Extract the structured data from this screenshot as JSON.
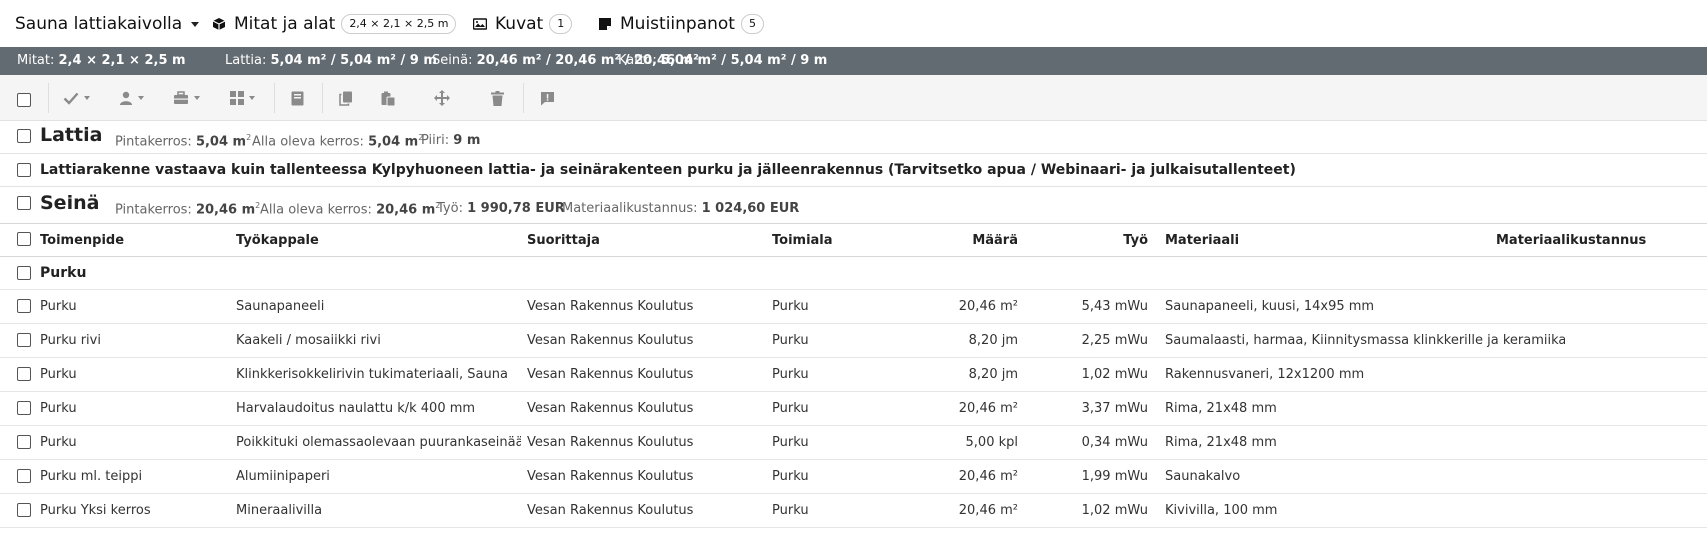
{
  "nav": {
    "title": "Sauna lattiakaivolla",
    "dimensions_label": "Mitat ja alat",
    "dimensions_badge": "2,4 × 2,1 × 2,5 m",
    "images_label": "Kuvat",
    "images_count": "1",
    "notes_label": "Muistiinpanot",
    "notes_count": "5"
  },
  "stats": {
    "mitat_label": "Mitat: ",
    "mitat_value": "2,4 × 2,1 × 2,5 m",
    "lattia_label": "Lattia: ",
    "lattia_value": "5,04 m² / 5,04 m² / 9 m",
    "seina_label": "Seinä: ",
    "seina_value": "20,46 m² / 20,46 m² / 20,46 m²",
    "katto_label": "Katto: ",
    "katto_value": "5,04 m² / 5,04 m² / 9 m"
  },
  "lattia": {
    "title": "Lattia",
    "surface_label": "Pintakerros: ",
    "surface_value": "5,04 m",
    "under_label": "Alla oleva kerros: ",
    "under_value": "5,04 m",
    "perimeter_label": "Piiri: ",
    "perimeter_value": "9 m"
  },
  "note_row": "Lattiarakenne vastaava kuin tallenteessa Kylpyhuoneen lattia- ja seinärakenteen purku ja jälleenrakennus (Tarvitsetko apua / Webinaari- ja julkaisutallenteet)",
  "seina": {
    "title": "Seinä",
    "surface_label": "Pintakerros: ",
    "surface_value": "20,46 m",
    "under_label": "Alla oleva kerros: ",
    "under_value": "20,46 m",
    "work_label": "Työ: ",
    "work_value": "1 990,78 EUR",
    "material_label": "Materiaalikustannus: ",
    "material_value": "1 024,60 EUR"
  },
  "table": {
    "headers": [
      "Toimenpide",
      "Työkappale",
      "Suorittaja",
      "Toimiala",
      "Määrä",
      "Työ",
      "Materiaali",
      "Materiaalikustannus"
    ],
    "group": "Purku",
    "rows": [
      [
        "Purku",
        "Saunapaneeli",
        "Vesan Rakennus Koulutus",
        "Purku",
        "20,46 m²",
        "5,43 mWu",
        "Saunapaneeli, kuusi, 14x95 mm"
      ],
      [
        "Purku rivi",
        "Kaakeli / mosaiikki rivi",
        "Vesan Rakennus Koulutus",
        "Purku",
        "8,20 jm",
        "2,25 mWu",
        "Saumalaasti, harmaa, Kiinnitysmassa klinkkerille ja keramiikal..."
      ],
      [
        "Purku",
        "Klinkkerisokkelirivin tukimateriaali, Sauna",
        "Vesan Rakennus Koulutus",
        "Purku",
        "8,20 jm",
        "1,02 mWu",
        "Rakennusvaneri, 12x1200 mm"
      ],
      [
        "Purku",
        "Harvalaudoitus naulattu k/k 400 mm",
        "Vesan Rakennus Koulutus",
        "Purku",
        "20,46 m²",
        "3,37 mWu",
        "Rima, 21x48 mm"
      ],
      [
        "Purku",
        "Poikkituki olemassaolevaan puurankaseinään",
        "Vesan Rakennus Koulutus",
        "Purku",
        "5,00 kpl",
        "0,34 mWu",
        "Rima, 21x48 mm"
      ],
      [
        "Purku ml. teippi",
        "Alumiinipaperi",
        "Vesan Rakennus Koulutus",
        "Purku",
        "20,46 m²",
        "1,99 mWu",
        "Saunakalvo"
      ],
      [
        "Purku Yksi kerros",
        "Mineraalivilla",
        "Vesan Rakennus Koulutus",
        "Purku",
        "20,46 m²",
        "1,02 mWu",
        "Kivivilla, 100 mm"
      ]
    ]
  }
}
